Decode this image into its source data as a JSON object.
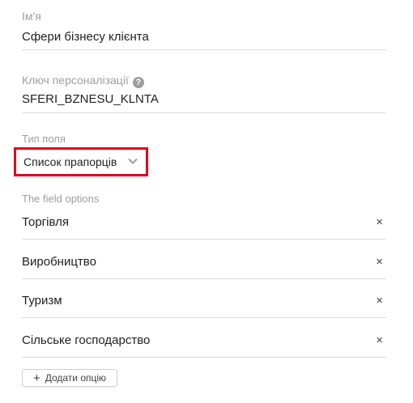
{
  "name_field": {
    "label": "Ім'я",
    "value": "Сфери бізнесу клієнта"
  },
  "key_field": {
    "label": "Ключ персоналізації",
    "help_icon": "help-icon",
    "help_glyph": "?",
    "value": "SFERI_BZNESU_KLNTA"
  },
  "type_field": {
    "label": "Тип поля",
    "selected": "Список прапорців",
    "highlight_color": "#e3001b"
  },
  "options": {
    "label": "The field options",
    "remove_glyph": "×",
    "items": [
      {
        "label": "Торгівля"
      },
      {
        "label": "Виробництво"
      },
      {
        "label": "Туризм"
      },
      {
        "label": "Сільське господарство"
      }
    ]
  },
  "add_option": {
    "icon": "plus-icon",
    "glyph": "+",
    "label": "Додати опцію"
  }
}
